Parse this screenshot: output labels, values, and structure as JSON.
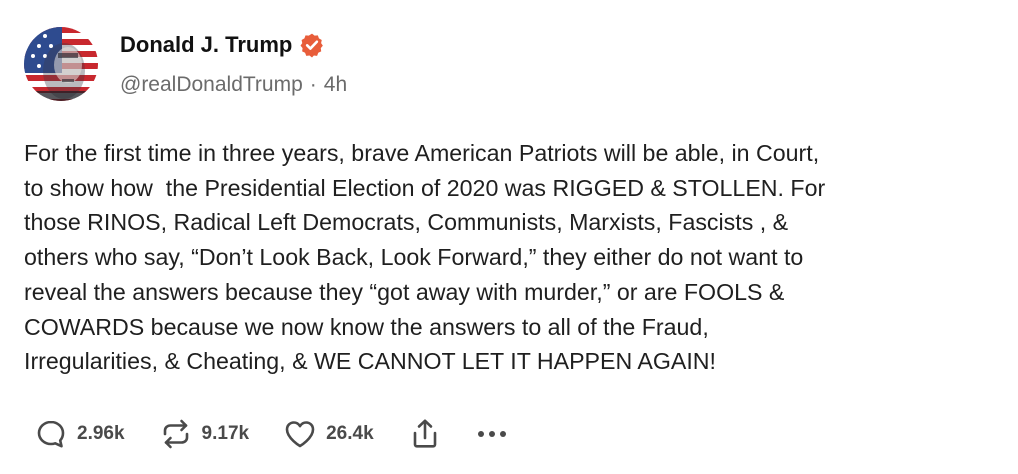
{
  "author": {
    "display_name": "Donald J. Trump",
    "handle": "@realDonaldTrump",
    "separator": "·",
    "time_ago": "4h",
    "verified": true,
    "verified_color": "#e85d3a"
  },
  "post": {
    "text": "For the first time in three years, brave American Patriots will be able, in Court,\nto show how  the Presidential Election of 2020 was RIGGED & STOLLEN. For\nthose RINOS, Radical Left Democrats, Communists, Marxists, Fascists , &\nothers who say, “Don’t Look Back, Look Forward,” they either do not want to\nreveal the answers because they “got away with murder,” or are FOOLS &\nCOWARDS because we now know the answers to all of the Fraud,\nIrregularities, & Cheating, & WE CANNOT LET IT HAPPEN AGAIN!"
  },
  "actions": {
    "reply": {
      "icon": "reply-bubble-icon",
      "count": "2.96k"
    },
    "retruth": {
      "icon": "retruth-arrows-icon",
      "count": "9.17k"
    },
    "like": {
      "icon": "heart-icon",
      "count": "26.4k"
    },
    "share": {
      "icon": "share-upload-icon"
    },
    "more": {
      "icon": "more-dots-icon"
    }
  },
  "colors": {
    "text": "#1f1f1f",
    "muted": "#6b6b6b",
    "icon": "#4a4a4a"
  }
}
